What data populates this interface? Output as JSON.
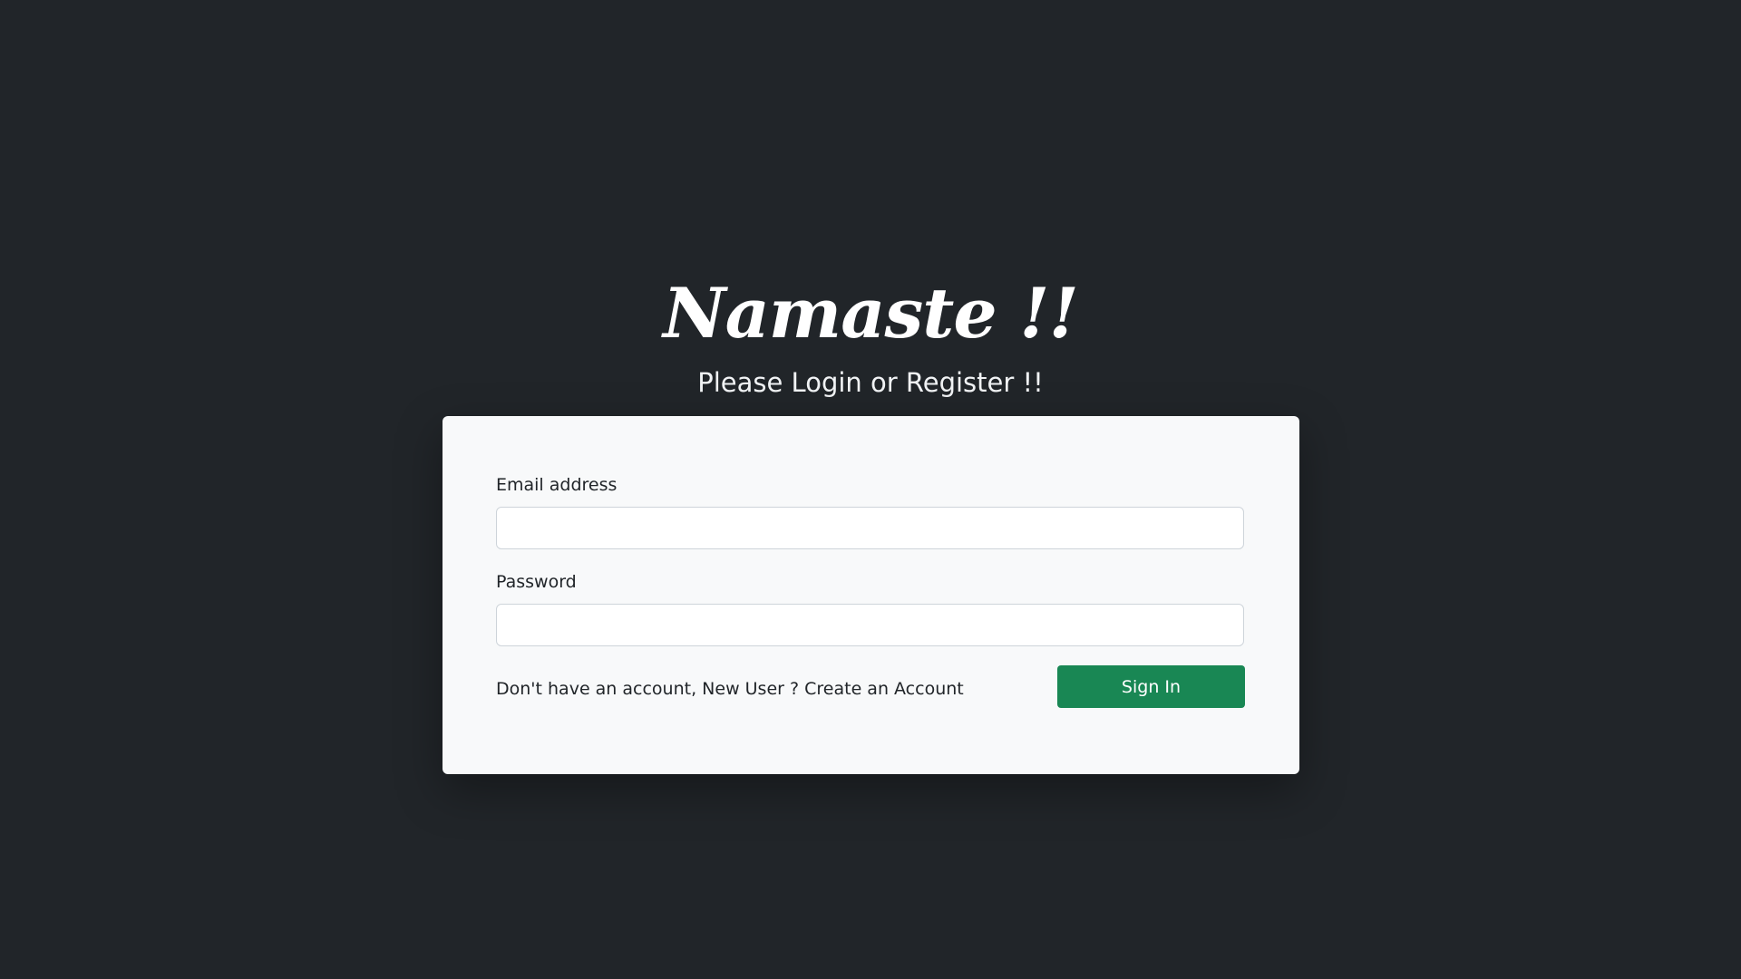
{
  "header": {
    "brand": "Namaste !!",
    "subtitle": "Please Login or Register !!"
  },
  "login_form": {
    "email_label": "Email address",
    "email_value": "",
    "password_label": "Password",
    "password_value": "",
    "register_prompt": "Don't have an account, New User ? ",
    "register_link": "Create an Account",
    "submit_label": "Sign In"
  },
  "colors": {
    "background": "#212529",
    "card": "#f8f9fa",
    "button": "#198754",
    "button_text": "#ffffff"
  }
}
